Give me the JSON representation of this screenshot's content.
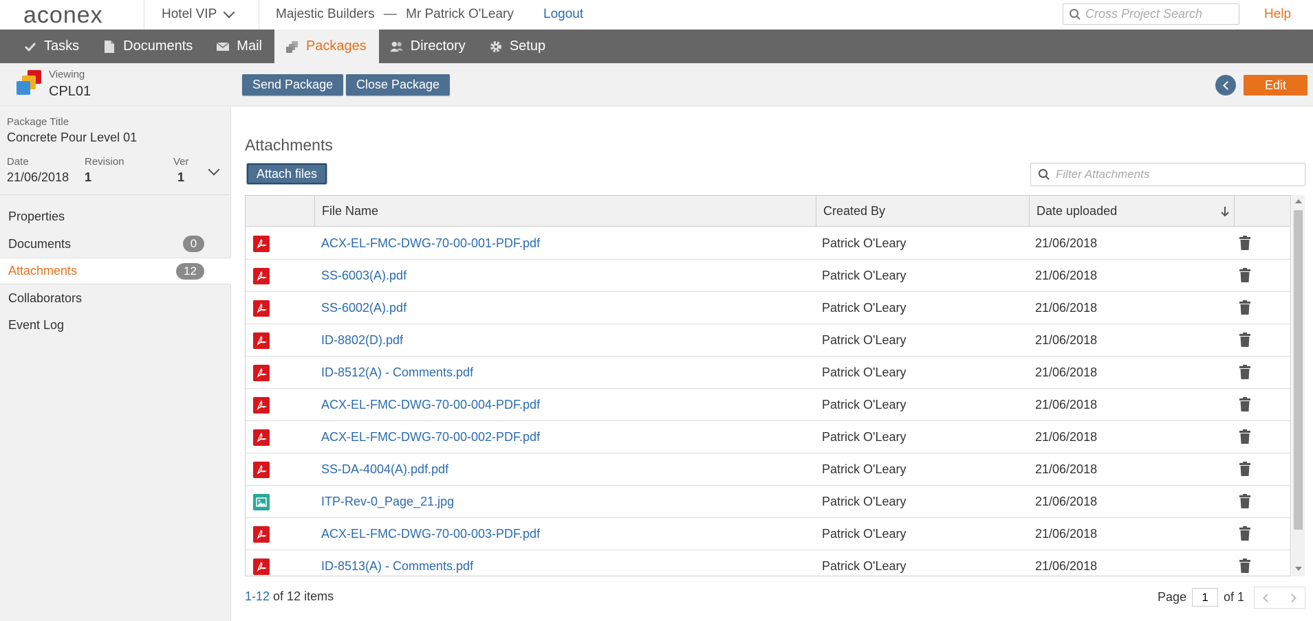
{
  "app": {
    "logo": "aconex",
    "project": "Hotel VIP",
    "org": "Majestic Builders",
    "dash": "—",
    "user": "Mr Patrick O'Leary",
    "logout": "Logout",
    "search_placeholder": "Cross Project Search",
    "help": "Help"
  },
  "nav": [
    {
      "label": "Tasks",
      "icon": "check-icon"
    },
    {
      "label": "Documents",
      "icon": "document-icon"
    },
    {
      "label": "Mail",
      "icon": "mail-icon"
    },
    {
      "label": "Packages",
      "icon": "packages-icon"
    },
    {
      "label": "Directory",
      "icon": "people-icon"
    },
    {
      "label": "Setup",
      "icon": "gear-icon"
    }
  ],
  "subheader": {
    "viewing_label": "Viewing",
    "viewing_value": "CPL01",
    "send_label": "Send Package",
    "close_label": "Close Package",
    "edit_label": "Edit"
  },
  "package": {
    "title_label": "Package Title",
    "title": "Concrete Pour Level 01",
    "date_label": "Date",
    "date": "21/06/2018",
    "revision_label": "Revision",
    "revision": "1",
    "ver_label": "Ver",
    "ver": "1"
  },
  "sidebar": [
    {
      "label": "Properties"
    },
    {
      "label": "Documents",
      "count": "0"
    },
    {
      "label": "Attachments",
      "count": "12"
    },
    {
      "label": "Collaborators"
    },
    {
      "label": "Event Log"
    }
  ],
  "main": {
    "title": "Attachments",
    "attach_label": "Attach files",
    "filter_placeholder": "Filter Attachments",
    "columns": {
      "file": "File Name",
      "created": "Created By",
      "date": "Date uploaded"
    },
    "rows": [
      {
        "file": "ACX-EL-FMC-DWG-70-00-001-PDF.pdf",
        "type": "pdf",
        "created": "Patrick O'Leary",
        "date": "21/06/2018"
      },
      {
        "file": "SS-6003(A).pdf",
        "type": "pdf",
        "created": "Patrick O'Leary",
        "date": "21/06/2018"
      },
      {
        "file": "SS-6002(A).pdf",
        "type": "pdf",
        "created": "Patrick O'Leary",
        "date": "21/06/2018"
      },
      {
        "file": "ID-8802(D).pdf",
        "type": "pdf",
        "created": "Patrick O'Leary",
        "date": "21/06/2018"
      },
      {
        "file": "ID-8512(A) - Comments.pdf",
        "type": "pdf",
        "created": "Patrick O'Leary",
        "date": "21/06/2018"
      },
      {
        "file": "ACX-EL-FMC-DWG-70-00-004-PDF.pdf",
        "type": "pdf",
        "created": "Patrick O'Leary",
        "date": "21/06/2018"
      },
      {
        "file": "ACX-EL-FMC-DWG-70-00-002-PDF.pdf",
        "type": "pdf",
        "created": "Patrick O'Leary",
        "date": "21/06/2018"
      },
      {
        "file": "SS-DA-4004(A).pdf.pdf",
        "type": "pdf",
        "created": "Patrick O'Leary",
        "date": "21/06/2018"
      },
      {
        "file": "ITP-Rev-0_Page_21.jpg",
        "type": "image",
        "created": "Patrick O'Leary",
        "date": "21/06/2018"
      },
      {
        "file": "ACX-EL-FMC-DWG-70-00-003-PDF.pdf",
        "type": "pdf",
        "created": "Patrick O'Leary",
        "date": "21/06/2018"
      },
      {
        "file": "ID-8513(A) - Comments.pdf",
        "type": "pdf",
        "created": "Patrick O'Leary",
        "date": "21/06/2018"
      }
    ],
    "footer": {
      "range": "1-12",
      "of_items": "of 12 items",
      "page_label": "Page",
      "page": "1",
      "of_pages": "of 1"
    }
  },
  "colors": {
    "accent": "#e8711c",
    "nav_bg": "#666666",
    "button": "#4d6f91",
    "link": "#2b6cb0",
    "pdf": "#d9161c",
    "image": "#2aa89a"
  }
}
